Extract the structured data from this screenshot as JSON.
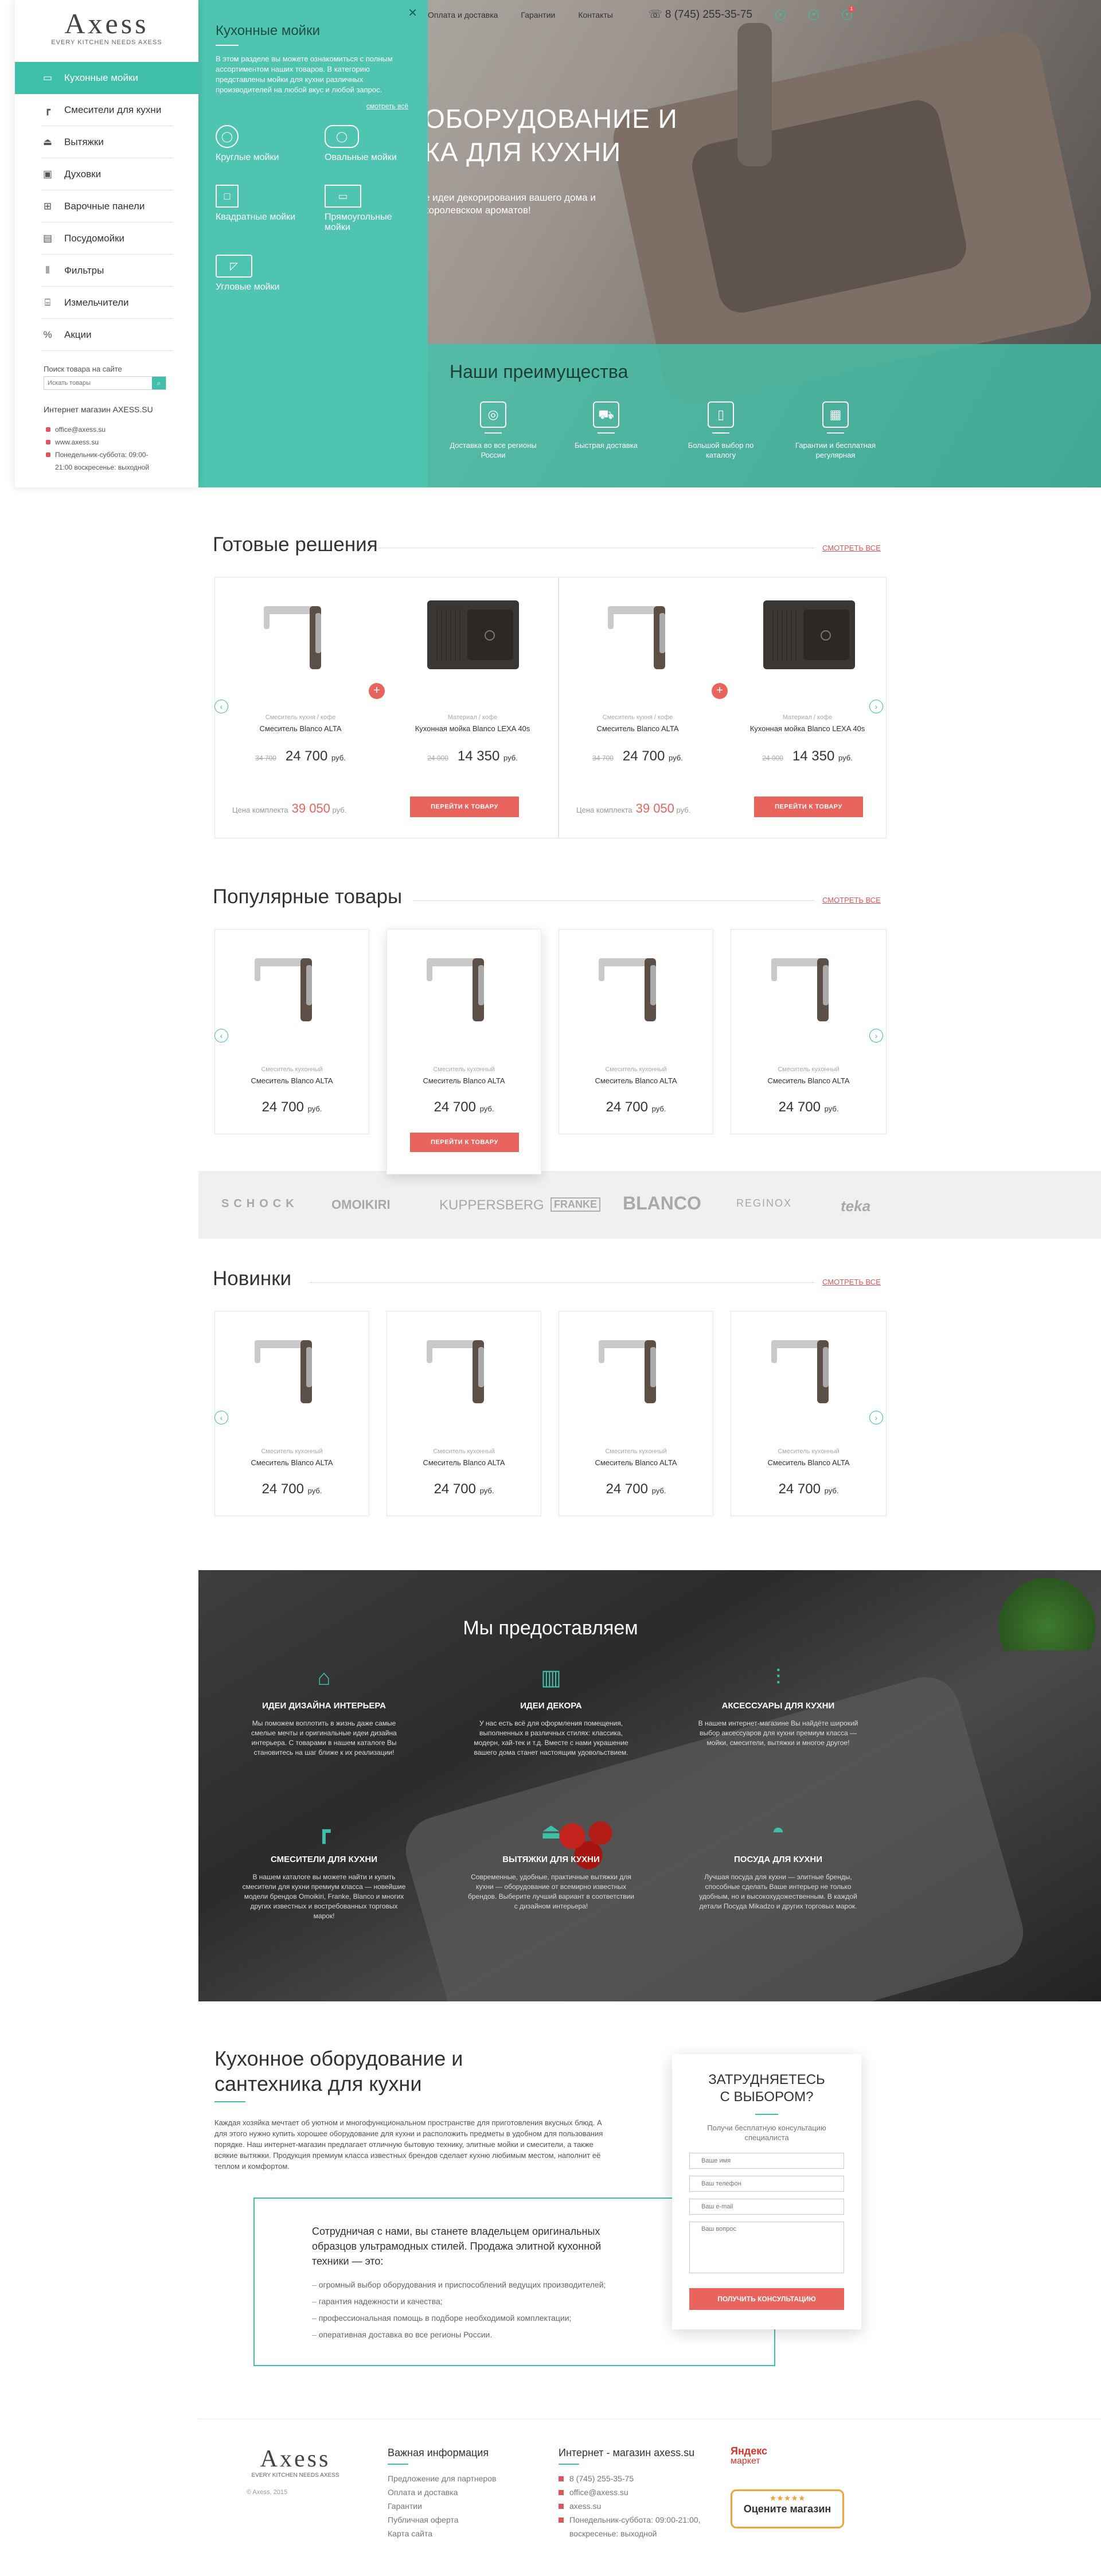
{
  "brand": {
    "logo": "Axess",
    "tagline": "EVERY KITCHEN NEEDS AXESS"
  },
  "sidebar": {
    "items": [
      {
        "label": "Кухонные мойки",
        "icon": "sink-icon"
      },
      {
        "label": "Смесители для кухни",
        "icon": "faucet-icon"
      },
      {
        "label": "Вытяжки",
        "icon": "hood-icon"
      },
      {
        "label": "Духовки",
        "icon": "oven-icon"
      },
      {
        "label": "Варочные панели",
        "icon": "cooktop-icon"
      },
      {
        "label": "Посудомойки",
        "icon": "dishwasher-icon"
      },
      {
        "label": "Фильтры",
        "icon": "filter-icon"
      },
      {
        "label": "Измельчители",
        "icon": "grinder-icon"
      },
      {
        "label": "Акции",
        "icon": "percent-icon"
      }
    ],
    "search_label": "Поиск товара на сайте",
    "search_placeholder": "Искать товары",
    "shop": "Интернет магазин AXESS.SU",
    "contacts": [
      "office@axess.su",
      "www.axess.su",
      "Понедельник-суббота: 09:00-21:00 воскресенье: выходной"
    ]
  },
  "submenu": {
    "title": "Кухонные мойки",
    "text": "В этом разделе вы можете ознакомиться с полным ассортиментом наших товаров. В категорию представлены мойки для кухни различных производителей на любой вкус и любой запрос.",
    "more": "смотреть всё",
    "items": [
      "Круглые мойки",
      "Овальные мойки",
      "Квадратные мойки",
      "Прямоугольные мойки",
      "Угловые мойки"
    ]
  },
  "topnav": {
    "links": [
      "Оплата и доставка",
      "Гарантии",
      "Контакты"
    ],
    "phone": "8 (745) 255-35-75",
    "cart_count": "1"
  },
  "hero": {
    "title_l1": "ОБОРУДОВАНИЕ И",
    "title_l2": "КА ДЛЯ КУХНИ",
    "subtitle": "е идеи декорирования вашего дома и королевском ароматов!"
  },
  "advantages": {
    "title": "Наши преимущества",
    "items": [
      "Доставка во все регионы России",
      "Быстрая доставка",
      "Большой выбор по каталогу",
      "Гарантии и бесплатная регулярная"
    ]
  },
  "ready": {
    "title": "Готовые решения",
    "more": "СМОТРЕТЬ ВСЕ",
    "kits": [
      {
        "p1": {
          "cat": "Смеситель кухня / кофе",
          "name": "Смеситель Blanco ALTA",
          "old": "34 700",
          "price": "24 700"
        },
        "p2": {
          "cat": "Материал / кофе",
          "name": "Кухонная мойка Blanco LEXA 40s",
          "old": "24 000",
          "price": "14 350"
        },
        "kit_label": "Цена комплекта",
        "kit_price": "39 050",
        "button": "ПЕРЕЙТИ К ТОВАРУ"
      },
      {
        "p1": {
          "cat": "Смеситель кухня / кофе",
          "name": "Смеситель Blanco ALTA",
          "old": "34 700",
          "price": "24 700"
        },
        "p2": {
          "cat": "Материал / кофе",
          "name": "Кухонная мойка Blanco LEXA 40s",
          "old": "24 000",
          "price": "14 350"
        },
        "kit_label": "Цена комплекта",
        "kit_price": "39 050",
        "button": "ПЕРЕЙТИ К ТОВАРУ"
      }
    ]
  },
  "currency": "руб.",
  "popular": {
    "title": "Популярные товары",
    "more": "СМОТРЕТЬ ВСЕ",
    "button": "ПЕРЕЙТИ К ТОВАРУ",
    "items": [
      {
        "cat": "Смеситель кухонный",
        "name": "Смеситель Blanco ALTA",
        "price": "24 700"
      },
      {
        "cat": "Смеситель кухонный",
        "name": "Смеситель Blanco ALTA",
        "price": "24 700"
      },
      {
        "cat": "Смеситель кухонный",
        "name": "Смеситель Blanco ALTA",
        "price": "24 700"
      },
      {
        "cat": "Смеситель кухонный",
        "name": "Смеситель Blanco ALTA",
        "price": "24 700"
      }
    ]
  },
  "brands": [
    "SCHOCK",
    "OMOIKIRI",
    "KUPPERSBERG",
    "FRANKE",
    "BLANCO",
    "REGINOX",
    "teka"
  ],
  "new": {
    "title": "Новинки",
    "more": "СМОТРЕТЬ ВСЕ",
    "items": [
      {
        "cat": "Смеситель кухонный",
        "name": "Смеситель Blanco ALTA",
        "price": "24 700"
      },
      {
        "cat": "Смеситель кухонный",
        "name": "Смеситель Blanco ALTA",
        "price": "24 700"
      },
      {
        "cat": "Смеситель кухонный",
        "name": "Смеситель Blanco ALTA",
        "price": "24 700"
      },
      {
        "cat": "Смеситель кухонный",
        "name": "Смеситель Blanco ALTA",
        "price": "24 700"
      }
    ]
  },
  "services": {
    "title": "Мы предоставляем",
    "items": [
      {
        "title": "ИДЕИ ДИЗАЙНА ИНТЕРЬЕРА",
        "text": "Мы поможем воплотить в жизнь даже самые смелые мечты и оригинальные идеи дизайна интерьера. С товарами в нашем каталоге Вы становитесь на шаг ближе к их реализации!"
      },
      {
        "title": "ИДЕИ ДЕКОРА",
        "text": "У нас есть всё для оформления помещения, выполненных в различных стилях: классика, модерн, хай-тек и т.д. Вместе с нами украшение вашего дома станет настоящим удовольствием."
      },
      {
        "title": "АКСЕССУАРЫ ДЛЯ КУХНИ",
        "text": "В нашем интернет-магазине Вы найдёте широкий выбор аксессуаров для кухни премиум класса — мойки, смесители, вытяжки и многое другое!"
      },
      {
        "title": "СМЕСИТЕЛИ ДЛЯ КУХНИ",
        "text": "В нашем каталоге вы можете найти и купить смесители для кухни премиум класса — новейшие модели брендов Omoikiri, Franke, Blanco и многих других известных и востребованных торговых марок!"
      },
      {
        "title": "ВЫТЯЖКИ ДЛЯ КУХНИ",
        "text": "Современные, удобные, практичные вытяжки для кухни — оборудование от всемирно известных брендов. Выберите лучший вариант в соответствии с дизайном интерьера!"
      },
      {
        "title": "ПОСУДА ДЛЯ КУХНИ",
        "text": "Лучшая посуда для кухни — элитные бренды, способные сделать Ваше интерьер не только удобным, но и высокохудожественным. В каждой детали Посуда Mikadzo и других торговых марок."
      }
    ]
  },
  "about": {
    "title_l1": "Кухонное оборудование и",
    "title_l2": "сантехника для кухни",
    "text": "Каждая хозяйка мечтает об уютном и многофункциональном пространстве для приготовления вкусных блюд. А для этого нужно купить хорошее оборудование для кухни и расположить предметы в удобном для пользования порядке. Наш интернет-магазин предлагает отличную бытовую технику, элитные мойки и смесители, а также всякие вытяжки. Продукция премиум класса известных брендов сделает кухню любимым местом, наполнит её теплом и комфортом.",
    "box_lead": "Сотрудничая с нами, вы станете владельцем оригинальных образцов ультрамодных стилей. Продажа элитной кухонной техники — это:",
    "box_items": [
      "огромный выбор оборудования и приспособлений ведущих производителей;",
      "гарантия надежности и качества;",
      "профессиональная помощь в подборе необходимой комплектации;",
      "оперативная доставка во все регионы России."
    ]
  },
  "form": {
    "title_l1": "ЗАТРУДНЯЕТЕСЬ",
    "title_l2": "С ВЫБОРОМ?",
    "desc": "Получи бесплатную консультацию специалиста",
    "name": "Ваше имя",
    "phone": "Ваш телефон",
    "email": "Ваш e-mail",
    "question": "Ваш вопрос",
    "submit": "ПОЛУЧИТЬ КОНСУЛЬТАЦИЮ"
  },
  "footer": {
    "copyright": "© Axess, 2015",
    "info_title": "Важная информация",
    "info_links": [
      "Предложение для партнеров",
      "Оплата и доставка",
      "Гарантии",
      "Публичная оферта",
      "Карта сайта"
    ],
    "contacts_title": "Интернет - магазин axess.su",
    "contacts": [
      "8 (745) 255-35-75",
      "office@axess.su",
      "axess.su",
      "Понедельник-суббота: 09:00-21:00, воскресенье: выходной"
    ],
    "ym_l1": "Яндекс",
    "ym_l2": "маркет",
    "ym_rate": "Оцените магазин"
  }
}
